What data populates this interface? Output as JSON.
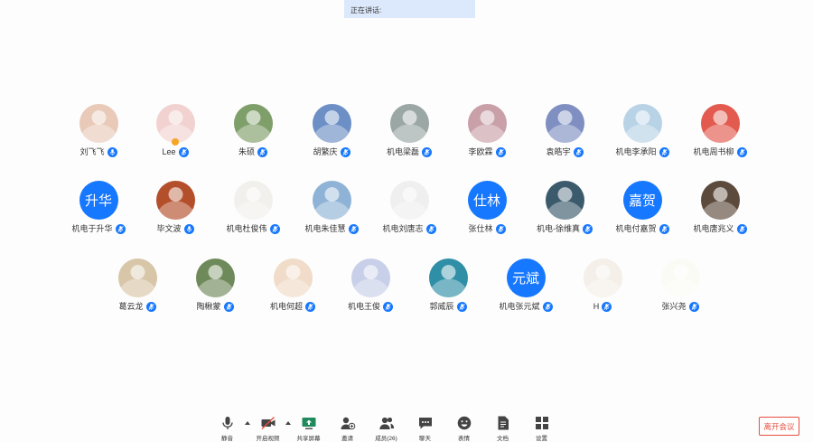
{
  "speaking_label": "正在讲话:",
  "participants": [
    {
      "name": "刘飞飞",
      "avatar": "photo",
      "color": "#e9c9b8",
      "mic": "active"
    },
    {
      "name": "Lee",
      "avatar": "photo",
      "color": "#f1d2d0",
      "mic": "muted",
      "host": true
    },
    {
      "name": "朱硕",
      "avatar": "photo",
      "color": "#7f9f6a",
      "mic": "muted"
    },
    {
      "name": "胡繁庆",
      "avatar": "photo",
      "color": "#6c8fc5",
      "mic": "muted"
    },
    {
      "name": "机电梁磊",
      "avatar": "photo",
      "color": "#9aa7a5",
      "mic": "muted"
    },
    {
      "name": "李欧霖",
      "avatar": "photo",
      "color": "#c9a0a8",
      "mic": "muted"
    },
    {
      "name": "袁皓宇",
      "avatar": "photo",
      "color": "#7f8fc2",
      "mic": "muted"
    },
    {
      "name": "机电李承阳",
      "avatar": "photo",
      "color": "#b9d3e6",
      "mic": "muted"
    },
    {
      "name": "机电周书柳",
      "avatar": "photo",
      "color": "#e25b4e",
      "mic": "muted"
    },
    {
      "name": "机电于升华",
      "avatar": "text",
      "initials": "升华",
      "mic": "muted"
    },
    {
      "name": "毕文波",
      "avatar": "photo",
      "color": "#b34f2b",
      "mic": "active"
    },
    {
      "name": "机电杜俊伟",
      "avatar": "photo",
      "color": "#f2f0ec",
      "mic": "muted"
    },
    {
      "name": "机电朱佳慧",
      "avatar": "photo",
      "color": "#8fb3d6",
      "mic": "muted"
    },
    {
      "name": "机电刘唐志",
      "avatar": "photo",
      "color": "#efefef",
      "mic": "muted"
    },
    {
      "name": "张仕林",
      "avatar": "text",
      "initials": "仕林",
      "mic": "muted"
    },
    {
      "name": "机电-徐维真",
      "avatar": "photo",
      "color": "#3b5a6c",
      "mic": "muted"
    },
    {
      "name": "机电付嘉贺",
      "avatar": "text",
      "initials": "嘉贺",
      "mic": "muted"
    },
    {
      "name": "机电唐兆义",
      "avatar": "photo",
      "color": "#5c4a3c",
      "mic": "muted"
    },
    {
      "name": "葛云龙",
      "avatar": "photo",
      "color": "#d8c6a8",
      "mic": "muted"
    },
    {
      "name": "陶楸蒙",
      "avatar": "photo",
      "color": "#6f8a5a",
      "mic": "muted"
    },
    {
      "name": "机电何超",
      "avatar": "photo",
      "color": "#f0dcc8",
      "mic": "muted"
    },
    {
      "name": "机电王俊",
      "avatar": "photo",
      "color": "#c8cfe8",
      "mic": "muted"
    },
    {
      "name": "郭威辰",
      "avatar": "photo",
      "color": "#2f8fa6",
      "mic": "muted"
    },
    {
      "name": "机电张元斌",
      "avatar": "text",
      "initials": "元斌",
      "mic": "muted"
    },
    {
      "name": "H",
      "avatar": "photo",
      "color": "#f4efe8",
      "mic": "muted"
    },
    {
      "name": "张兴尧",
      "avatar": "photo",
      "color": "#fbfbf6",
      "mic": "muted"
    }
  ],
  "toolbar": [
    {
      "label": "静音",
      "icon": "microphone-icon",
      "caret": true
    },
    {
      "label": "开启视频",
      "icon": "video-off-icon",
      "caret": true
    },
    {
      "label": "共享屏幕",
      "icon": "share-screen-icon"
    },
    {
      "label": "邀请",
      "icon": "invite-icon"
    },
    {
      "label": "成员(26)",
      "icon": "members-icon"
    },
    {
      "label": "聊天",
      "icon": "chat-icon"
    },
    {
      "label": "表情",
      "icon": "emoji-icon"
    },
    {
      "label": "文档",
      "icon": "document-icon"
    },
    {
      "label": "设置",
      "icon": "settings-icon"
    }
  ],
  "leave_label": "离开会议",
  "colors": {
    "accent": "#1677ff",
    "banner": "#dce8fb",
    "leave": "#e84c3d"
  }
}
